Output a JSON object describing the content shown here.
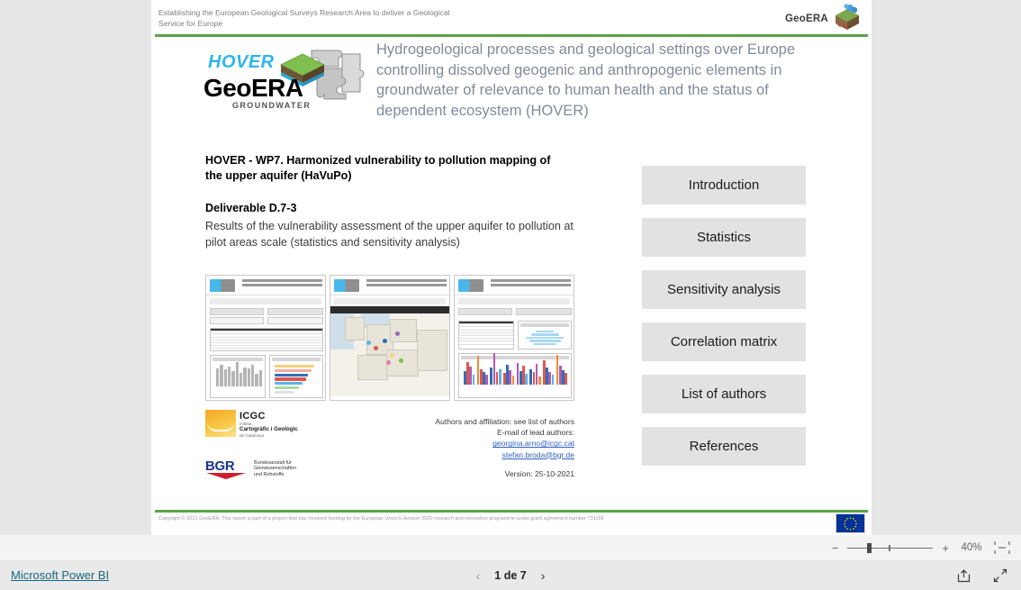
{
  "header": {
    "tagline": "Establishing the European Geological Surveys Research Area to deliver a Geological Service for Europe",
    "brand": "GeoERA"
  },
  "logo": {
    "hover": "HOVER",
    "geoera": "GeoERA",
    "groundwater": "GROUNDWATER"
  },
  "title": "Hydrogeological processes and geological settings over Europe controlling dissolved geogenic and anthropogenic elements in groundwater of relevance to human health and the status of dependent ecosystem (HOVER)",
  "content": {
    "wp_heading": "HOVER - WP7. Harmonized vulnerability to pollution mapping of the upper aquifer (HaVuPo)",
    "deliverable_heading": "Deliverable D.7-3",
    "deliverable_body": "Results of the vulnerability assessment of the upper aquifer to pollution at pilot areas scale (statistics and sensitivity analysis)"
  },
  "nav": {
    "buttons": [
      {
        "label": "Introduction"
      },
      {
        "label": "Statistics"
      },
      {
        "label": "Sensitivity analysis"
      },
      {
        "label": "Correlation matrix"
      },
      {
        "label": "List of authors"
      },
      {
        "label": "References"
      }
    ]
  },
  "thumbnails": [
    {
      "name": "statistics-dashboard-thumbnail"
    },
    {
      "name": "europe-map-thumbnail"
    },
    {
      "name": "sensitivity-analysis-thumbnail"
    }
  ],
  "institutes": {
    "icgc": {
      "abbr": "ICGC",
      "line1": "Institut",
      "line2": "Cartogràfic i Geològic",
      "line3": "de Catalunya"
    },
    "bgr": {
      "abbr": "BGR",
      "line1": "Bundesanstalt für",
      "line2": "Geowissenschaften",
      "line3": "und Rohstoffe"
    }
  },
  "contact": {
    "authors_line": "Authors and affiliation:  see list of authors",
    "email_label": "E-mail of lead authors:",
    "email1": "georgina.arno@icgc.cat",
    "email2": "stefan.broda@bgr.de",
    "version": "Version: 25-10-2021"
  },
  "footer": {
    "copyright": "Copyright © 2021 GeoERA. This report is part of a project that has  received funding by  the European Union's Horizon 2020 research and innovation programme under grant agreement number 731166",
    "geoera_word": "GeoERA"
  },
  "zoom": {
    "minus": "−",
    "plus": "+",
    "value": "40%"
  },
  "statusbar": {
    "powerbi_label": "Microsoft Power BI",
    "page_label": "1 de 7",
    "prev": "‹",
    "next": "›"
  },
  "colors": {
    "green_rule": "#5aa34a",
    "title_gray": "#808b9a",
    "button_bg": "#e2e2e2",
    "link_blue": "#2f5fbf",
    "powerbi_teal": "#16697e",
    "hover_cyan": "#2fb6ef",
    "eu_blue": "#003399",
    "eu_star": "#ffcc00"
  }
}
